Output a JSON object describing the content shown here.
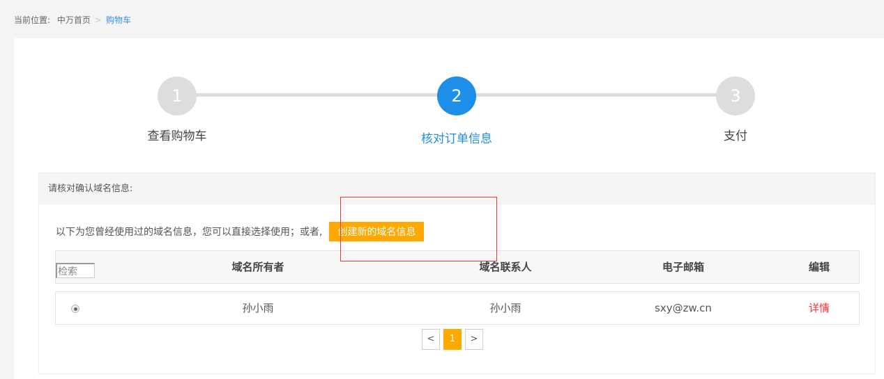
{
  "breadcrumb": {
    "prefix": "当前位置:",
    "home": "中万首页",
    "current": "购物车"
  },
  "steps": [
    {
      "num": "1",
      "label": "查看购物车"
    },
    {
      "num": "2",
      "label": "核对订单信息"
    },
    {
      "num": "3",
      "label": "支付"
    }
  ],
  "panel": {
    "title": "请核对确认域名信息:",
    "intro": "以下为您曾经使用过的域名信息，您可以直接选择使用；或者,",
    "create_button": "创建新的域名信息"
  },
  "table": {
    "search_value": "检索",
    "headers": [
      "域名所有者",
      "域名联系人",
      "电子邮箱",
      "编辑"
    ],
    "rows": [
      {
        "owner": "孙小雨",
        "contact": "孙小雨",
        "email": "sxy@zw.cn",
        "action": "详情"
      }
    ]
  },
  "pagination": {
    "prev": "<",
    "current": "1",
    "next": ">"
  },
  "colors": {
    "accent": "#1e8fe8",
    "button": "#ffa800",
    "danger": "#e33"
  }
}
